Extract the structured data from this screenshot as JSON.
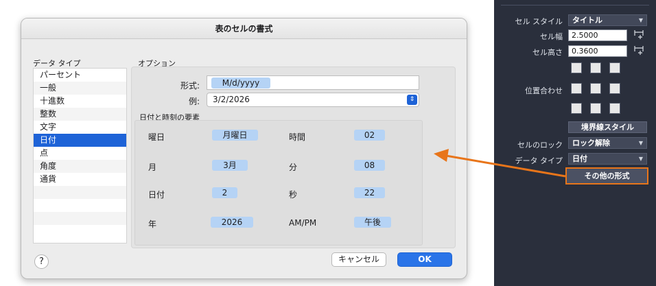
{
  "dialog": {
    "title": "表のセルの書式",
    "data_type_label": "データ タイプ",
    "options_label": "オプション",
    "data_types": [
      "パーセント",
      "一般",
      "十進数",
      "整数",
      "文字",
      "日付",
      "点",
      "角度",
      "通貨"
    ],
    "selected_data_type": "日付",
    "format_label": "形式:",
    "format_token": "M/d/yyyy",
    "example_label": "例:",
    "example_value": "3/2/2026",
    "elements_label": "日付と時刻の要素",
    "elements": {
      "weekday_label": "曜日",
      "weekday_value": "月曜日",
      "hour_label": "時間",
      "hour_value": "02",
      "month_label": "月",
      "month_value": "3月",
      "minute_label": "分",
      "minute_value": "08",
      "day_label": "日付",
      "day_value": "2",
      "second_label": "秒",
      "second_value": "22",
      "year_label": "年",
      "year_value": "2026",
      "ampm_label": "AM/PM",
      "ampm_value": "午後"
    },
    "help_label": "?",
    "cancel_label": "キャンセル",
    "ok_label": "OK"
  },
  "inspector": {
    "cell_style_label": "セル スタイル",
    "cell_style_value": "タイトル",
    "cell_width_label": "セル幅",
    "cell_width_value": "2.5000",
    "cell_height_label": "セル高さ",
    "cell_height_value": "0.3600",
    "alignment_label": "位置合わせ",
    "border_style_label": "境界線スタイル",
    "cell_lock_label": "セルのロック",
    "cell_lock_value": "ロック解除",
    "data_type_label": "データ タイプ",
    "data_type_value": "日付",
    "other_format_label": "その他の形式"
  },
  "colors": {
    "selection": "#1e63d7",
    "token": "#b5d3f5",
    "panel_bg": "#2a2f3c",
    "annotation_arrow": "#e8751a"
  }
}
